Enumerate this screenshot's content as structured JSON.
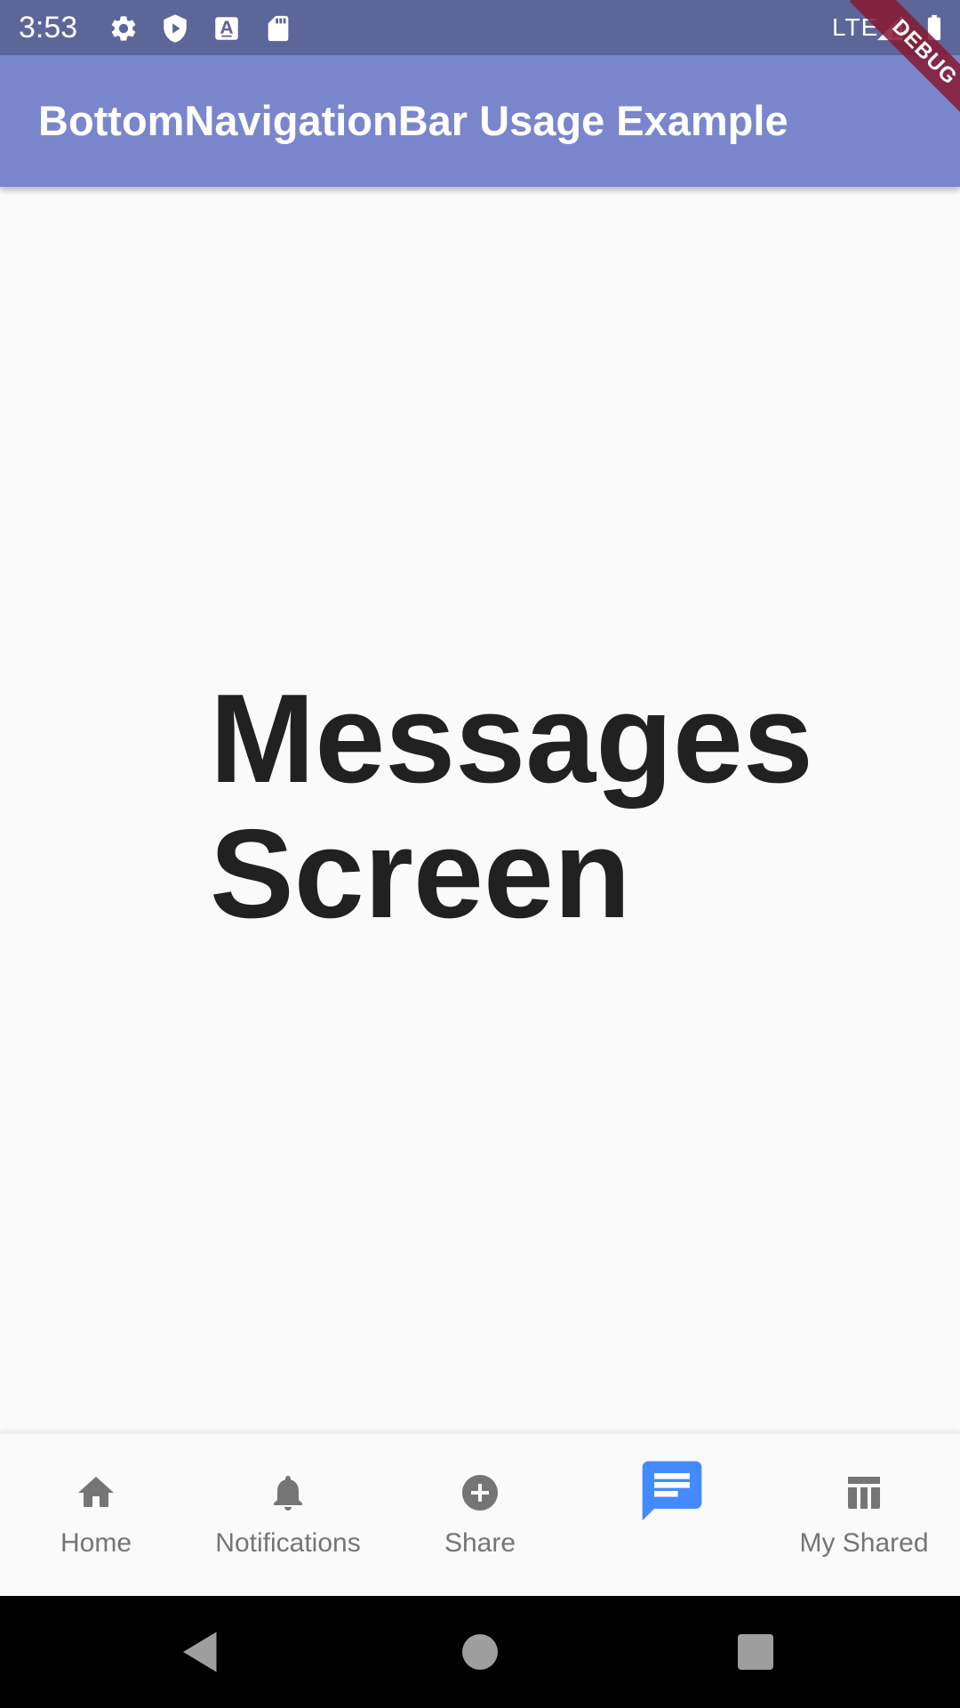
{
  "status_bar": {
    "time": "3:53",
    "network": "LTE",
    "icons": [
      "settings-icon",
      "shield-play-icon",
      "text-input-icon",
      "sd-card-icon",
      "signal-icon",
      "battery-icon"
    ]
  },
  "app_bar": {
    "title": "BottomNavigationBar Usage Example",
    "color": "#7986cb"
  },
  "debug_banner": {
    "label": "DEBUG"
  },
  "main": {
    "title": "Messages Screen"
  },
  "bottom_nav": {
    "active_index": 3,
    "active_color": "#448aff",
    "inactive_color": "#757575",
    "items": [
      {
        "label": "Home",
        "icon": "home-icon"
      },
      {
        "label": "Notifications",
        "icon": "bell-icon"
      },
      {
        "label": "Share",
        "icon": "add-circle-icon"
      },
      {
        "label": "",
        "icon": "message-icon"
      },
      {
        "label": "My Shared",
        "icon": "library-icon"
      }
    ]
  },
  "system_nav": {
    "buttons": [
      "back-icon",
      "home-circle-icon",
      "recents-icon"
    ]
  }
}
